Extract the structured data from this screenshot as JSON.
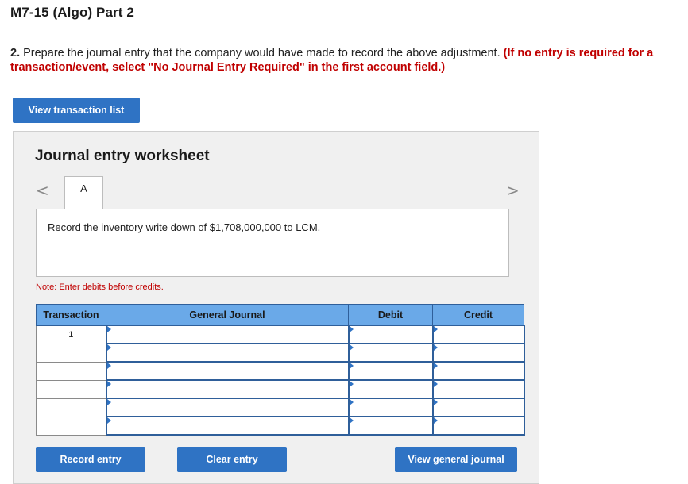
{
  "page": {
    "title": "M7-15 (Algo) Part 2"
  },
  "question": {
    "number": "2.",
    "text": " Prepare the journal entry that the company would have made to record the above adjustment. ",
    "instruction": "(If no entry is required for a transaction/event, select \"No Journal Entry Required\" in the first account field.)"
  },
  "buttons": {
    "view_transaction_list": "View transaction list",
    "record_entry": "Record entry",
    "clear_entry": "Clear entry",
    "view_general_journal": "View general journal"
  },
  "worksheet": {
    "title": "Journal entry worksheet",
    "nav_prev": "<",
    "nav_next": ">",
    "active_tab": "A",
    "description": "Record the inventory write down of $1,708,000,000 to LCM.",
    "note": "Note: Enter debits before credits."
  },
  "journal_table": {
    "headers": [
      "Transaction",
      "General Journal",
      "Debit",
      "Credit"
    ],
    "rows": [
      {
        "transaction": "1",
        "account": "",
        "debit": "",
        "credit": ""
      },
      {
        "transaction": "",
        "account": "",
        "debit": "",
        "credit": ""
      },
      {
        "transaction": "",
        "account": "",
        "debit": "",
        "credit": ""
      },
      {
        "transaction": "",
        "account": "",
        "debit": "",
        "credit": ""
      },
      {
        "transaction": "",
        "account": "",
        "debit": "",
        "credit": ""
      },
      {
        "transaction": "",
        "account": "",
        "debit": "",
        "credit": ""
      }
    ]
  },
  "colors": {
    "button_blue": "#2f73c4",
    "header_blue": "#6aa9e8",
    "instruction_red": "#c00000"
  }
}
